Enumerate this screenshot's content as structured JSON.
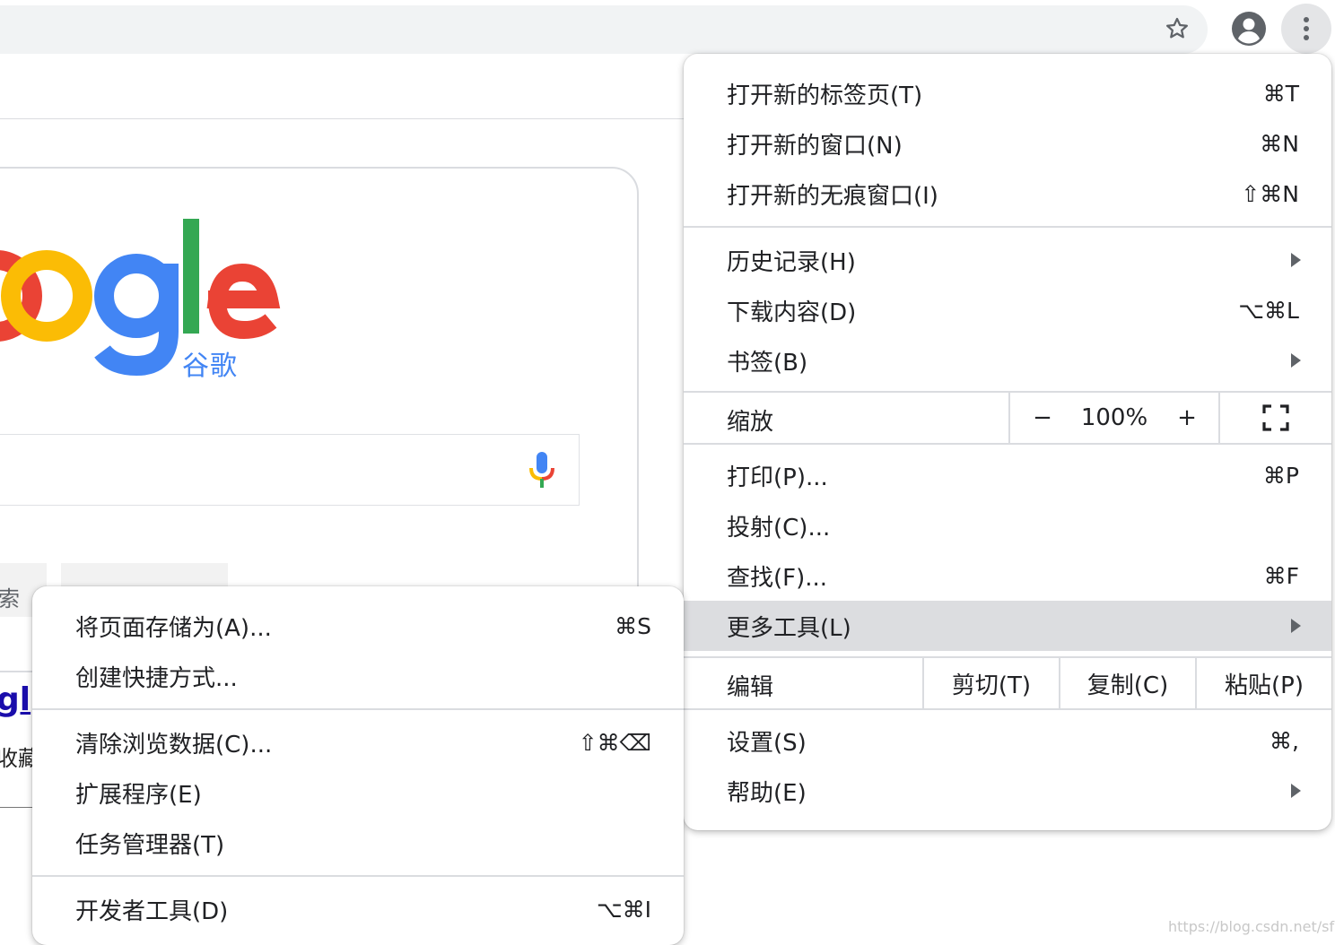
{
  "toolbar": {
    "star_icon": "star-icon",
    "profile_icon": "account-icon",
    "menu_icon": "more-vert-icon"
  },
  "page": {
    "logo_sub": "谷歌",
    "search_btn_fragment": "索",
    "left_link_fragment": "gl",
    "left_text_fragment": "收藏",
    "watermark": "https://blog.csdn.net/sfhtjj"
  },
  "main_menu": {
    "new_tab": {
      "label": "打开新的标签页(T)",
      "shortcut": "⌘T"
    },
    "new_window": {
      "label": "打开新的窗口(N)",
      "shortcut": "⌘N"
    },
    "new_incognito": {
      "label": "打开新的无痕窗口(I)",
      "shortcut": "⇧⌘N"
    },
    "history": {
      "label": "历史记录(H)"
    },
    "downloads": {
      "label": "下载内容(D)",
      "shortcut": "⌥⌘L"
    },
    "bookmarks": {
      "label": "书签(B)"
    },
    "zoom": {
      "label": "缩放",
      "minus": "−",
      "value": "100%",
      "plus": "+"
    },
    "print": {
      "label": "打印(P)...",
      "shortcut": "⌘P"
    },
    "cast": {
      "label": "投射(C)..."
    },
    "find": {
      "label": "查找(F)...",
      "shortcut": "⌘F"
    },
    "more_tools": {
      "label": "更多工具(L)"
    },
    "edit": {
      "label": "编辑",
      "cut": "剪切(T)",
      "copy": "复制(C)",
      "paste": "粘贴(P)"
    },
    "settings": {
      "label": "设置(S)",
      "shortcut": "⌘,"
    },
    "help": {
      "label": "帮助(E)"
    }
  },
  "sub_menu": {
    "save_page": {
      "label": "将页面存储为(A)...",
      "shortcut": "⌘S"
    },
    "create_shortcut": {
      "label": "创建快捷方式..."
    },
    "clear_data": {
      "label": "清除浏览数据(C)...",
      "shortcut": "⇧⌘⌫"
    },
    "extensions": {
      "label": "扩展程序(E)"
    },
    "task_manager": {
      "label": "任务管理器(T)"
    },
    "dev_tools": {
      "label": "开发者工具(D)",
      "shortcut": "⌥⌘I"
    }
  }
}
